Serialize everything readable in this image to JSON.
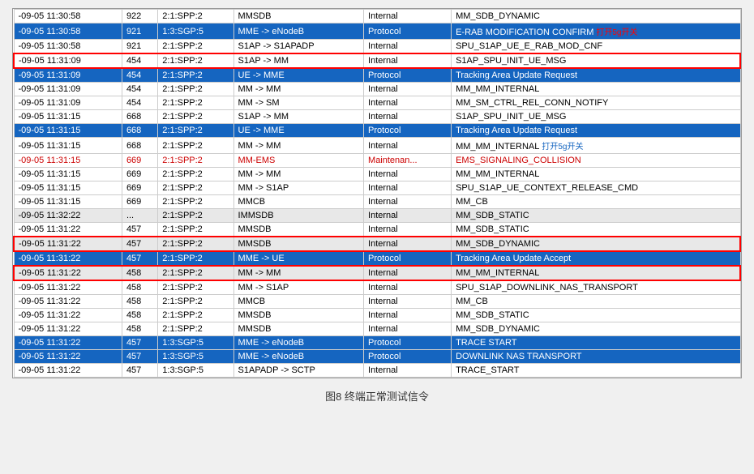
{
  "caption": "图8  终端正常测试信令",
  "colors": {
    "blue_row": "#1565C0",
    "white": "#ffffff",
    "red": "#cc0000",
    "normal_bg": "#ffffff",
    "alt_bg": "#e8e8e8"
  },
  "rows": [
    {
      "time": "-09-05 11:30:58",
      "num": "922",
      "source": "2:1:SPP:2",
      "msg": "MMSDB",
      "type": "Internal",
      "desc": "MM_SDB_DYNAMIC",
      "style": "normal"
    },
    {
      "time": "-09-05 11:30:58",
      "num": "921",
      "source": "1:3:SGP:5",
      "msg": "MME -> eNodeB",
      "type": "Protocol",
      "desc": "E-RAB MODIFICATION CONFIRM",
      "style": "blue",
      "annotation": "打开5g开关",
      "ann_color": "red"
    },
    {
      "time": "-09-05 11:30:58",
      "num": "921",
      "source": "2:1:SPP:2",
      "msg": "S1AP -> S1APADP",
      "type": "Internal",
      "desc": "SPU_S1AP_UE_E_RAB_MOD_CNF",
      "style": "normal"
    },
    {
      "time": "-09-05 11:31:09",
      "num": "454",
      "source": "2:1:SPP:2",
      "msg": "S1AP -> MM",
      "type": "Internal",
      "desc": "S1AP_SPU_INIT_UE_MSG",
      "style": "normal",
      "red_border": true
    },
    {
      "time": "-09-05 11:31:09",
      "num": "454",
      "source": "2:1:SPP:2",
      "msg": "UE -> MME",
      "type": "Protocol",
      "desc": "Tracking Area Update Request",
      "style": "blue"
    },
    {
      "time": "-09-05 11:31:09",
      "num": "454",
      "source": "2:1:SPP:2",
      "msg": "MM -> MM",
      "type": "Internal",
      "desc": "MM_MM_INTERNAL",
      "style": "normal"
    },
    {
      "time": "-09-05 11:31:09",
      "num": "454",
      "source": "2:1:SPP:2",
      "msg": "MM -> SM",
      "type": "Internal",
      "desc": "MM_SM_CTRL_REL_CONN_NOTIFY",
      "style": "normal"
    },
    {
      "time": "-09-05 11:31:15",
      "num": "668",
      "source": "2:1:SPP:2",
      "msg": "S1AP -> MM",
      "type": "Internal",
      "desc": "S1AP_SPU_INIT_UE_MSG",
      "style": "normal"
    },
    {
      "time": "-09-05 11:31:15",
      "num": "668",
      "source": "2:1:SPP:2",
      "msg": "UE -> MME",
      "type": "Protocol",
      "desc": "Tracking Area Update Request",
      "style": "blue"
    },
    {
      "time": "-09-05 11:31:15",
      "num": "668",
      "source": "2:1:SPP:2",
      "msg": "MM -> MM",
      "type": "Internal",
      "desc": "MM_MM_INTERNAL",
      "style": "normal",
      "annotation": "打开5g开关",
      "ann_color": "blue"
    },
    {
      "time": "-09-05 11:31:15",
      "num": "669",
      "source": "2:1:SPP:2",
      "msg": "MM-EMS",
      "type": "Maintenan...",
      "desc": "EMS_SIGNALING_COLLISION",
      "style": "red"
    },
    {
      "time": "-09-05 11:31:15",
      "num": "669",
      "source": "2:1:SPP:2",
      "msg": "MM -> MM",
      "type": "Internal",
      "desc": "MM_MM_INTERNAL",
      "style": "normal"
    },
    {
      "time": "-09-05 11:31:15",
      "num": "669",
      "source": "2:1:SPP:2",
      "msg": "MM -> S1AP",
      "type": "Internal",
      "desc": "SPU_S1AP_UE_CONTEXT_RELEASE_CMD",
      "style": "normal"
    },
    {
      "time": "-09-05 11:31:15",
      "num": "669",
      "source": "2:1:SPP:2",
      "msg": "MMCB",
      "type": "Internal",
      "desc": "MM_CB",
      "style": "normal"
    },
    {
      "time": "-09-05 11:32:22",
      "num": "...",
      "source": "2:1:SPP:2",
      "msg": "IMMSDB",
      "type": "Internal",
      "desc": "MM_SDB_STATIC",
      "style": "alt"
    },
    {
      "time": "-09-05 11:31:22",
      "num": "457",
      "source": "2:1:SPP:2",
      "msg": "MMSDB",
      "type": "Internal",
      "desc": "MM_SDB_STATIC",
      "style": "normal"
    },
    {
      "time": "-09-05 11:31:22",
      "num": "457",
      "source": "2:1:SPP:2",
      "msg": "MMSDB",
      "type": "Internal",
      "desc": "MM_SDB_DYNAMIC",
      "style": "alt",
      "red_border": true
    },
    {
      "time": "-09-05 11:31:22",
      "num": "457",
      "source": "2:1:SPP:2",
      "msg": "MME -> UE",
      "type": "Protocol",
      "desc": "Tracking Area Update Accept",
      "style": "blue"
    },
    {
      "time": "-09-05 11:31:22",
      "num": "458",
      "source": "2:1:SPP:2",
      "msg": "MM -> MM",
      "type": "Internal",
      "desc": "MM_MM_INTERNAL",
      "style": "alt",
      "red_border": true
    },
    {
      "time": "-09-05 11:31:22",
      "num": "458",
      "source": "2:1:SPP:2",
      "msg": "MM -> S1AP",
      "type": "Internal",
      "desc": "SPU_S1AP_DOWNLINK_NAS_TRANSPORT",
      "style": "normal"
    },
    {
      "time": "-09-05 11:31:22",
      "num": "458",
      "source": "2:1:SPP:2",
      "msg": "MMCB",
      "type": "Internal",
      "desc": "MM_CB",
      "style": "normal"
    },
    {
      "time": "-09-05 11:31:22",
      "num": "458",
      "source": "2:1:SPP:2",
      "msg": "MMSDB",
      "type": "Internal",
      "desc": "MM_SDB_STATIC",
      "style": "normal"
    },
    {
      "time": "-09-05 11:31:22",
      "num": "458",
      "source": "2:1:SPP:2",
      "msg": "MMSDB",
      "type": "Internal",
      "desc": "MM_SDB_DYNAMIC",
      "style": "normal"
    },
    {
      "time": "-09-05 11:31:22",
      "num": "457",
      "source": "1:3:SGP:5",
      "msg": "MME -> eNodeB",
      "type": "Protocol",
      "desc": "TRACE START",
      "style": "blue"
    },
    {
      "time": "-09-05 11:31:22",
      "num": "457",
      "source": "1:3:SGP:5",
      "msg": "MME -> eNodeB",
      "type": "Protocol",
      "desc": "DOWNLINK NAS TRANSPORT",
      "style": "blue"
    },
    {
      "time": "-09-05 11:31:22",
      "num": "457",
      "source": "1:3:SGP:5",
      "msg": "S1APADP -> SCTP",
      "type": "Internal",
      "desc": "TRACE_START",
      "style": "normal"
    }
  ]
}
